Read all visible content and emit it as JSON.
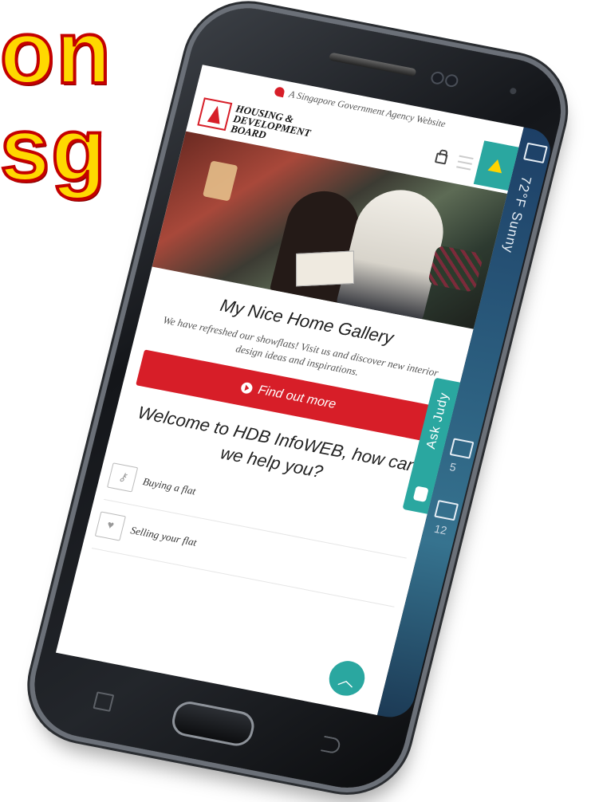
{
  "headline": {
    "line1": "on",
    "line2": "sg"
  },
  "edge_panel": {
    "weather": "72°F Sunny",
    "mail_count": "5",
    "calendar_count": "12"
  },
  "screen": {
    "gov_banner": "A Singapore Government Agency Website",
    "logo": {
      "line1": "HOUSING &",
      "line2": "DEVELOPMENT",
      "line3": "BOARD"
    },
    "gallery": {
      "title": "My Nice Home Gallery",
      "description": "We have refreshed our showflats! Visit us and discover new interior design ideas and inspirations.",
      "cta_label": "Find out more"
    },
    "ask_tab": "Ask Judy",
    "welcome": "Welcome to HDB InfoWEB, how can we help you?",
    "help_items": [
      {
        "label": "Buying a flat",
        "icon": "key-icon"
      },
      {
        "label": "Selling your flat",
        "icon": "heart-house-icon"
      }
    ]
  },
  "colors": {
    "hdb_red": "#d71e28",
    "teal": "#2aa7a0",
    "headline_yellow": "#ffd800",
    "headline_outline": "#c40000"
  }
}
